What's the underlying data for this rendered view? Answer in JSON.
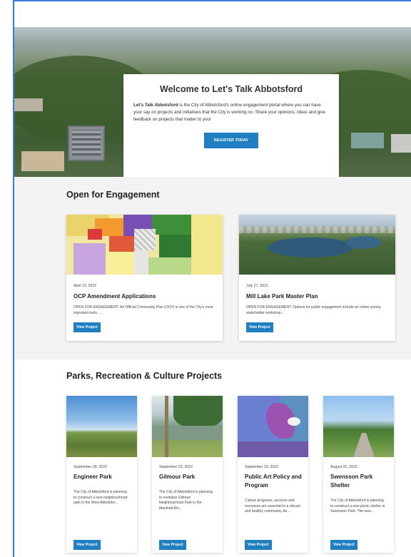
{
  "hero": {
    "title": "Welcome to Let's Talk Abbotsford",
    "intro_bold": "Let's Talk Abbotsford",
    "intro_rest": " is the City of Abbotsford's online engagement portal where you can have your say on projects and initiatives that the City is working on. Share your opinions, ideas and give feedback on projects that matter to you!",
    "register_label": "REGISTER TODAY"
  },
  "engagement": {
    "heading": "Open for Engagement",
    "cards": [
      {
        "date": "April 12, 2022",
        "title": "OCP Amendment Applications",
        "desc": "OPEN FOR ENGAGEMENT: An Official Community Plan (OCP) is one of the City's most important tools. ...",
        "button": "View Project"
      },
      {
        "date": "July 27, 2021",
        "title": "Mill Lake Park Master Plan",
        "desc": "OPEN FOR ENGAGEMENT: Options for public engagement include an online survey, stakeholder workshop...",
        "button": "View Project"
      }
    ]
  },
  "parks": {
    "heading": "Parks, Recreation & Culture Projects",
    "cards": [
      {
        "date": "September 28, 2022",
        "title": "Engineer Park",
        "desc": "The City of Abbotsford is planning to construct a new neighbourhood park in the West Abbotsfor...",
        "button": "View Project"
      },
      {
        "date": "September 23, 2022",
        "title": "Gilmour Park",
        "desc": "The City of Abbotsford is planning to revitalize Gilmour Neighbourhood Park in the Marshall-Mo...",
        "button": "View Project"
      },
      {
        "date": "September 19, 2022",
        "title": "Public Art Policy and Program",
        "desc": "Culture programs, services and resources are essential to a vibrant and healthy community. As ...",
        "button": "View Project"
      },
      {
        "date": "August 31, 2022",
        "title": "Swensson Park Shelter",
        "desc": "The City of Abbotsford is planning to construct a new picnic shelter in Swensson Park. The new...",
        "button": "View Project"
      }
    ]
  },
  "colors": {
    "accent": "#1f7fc1",
    "frame": "#3a7bd5",
    "section_grey": "#f3f3f3"
  }
}
